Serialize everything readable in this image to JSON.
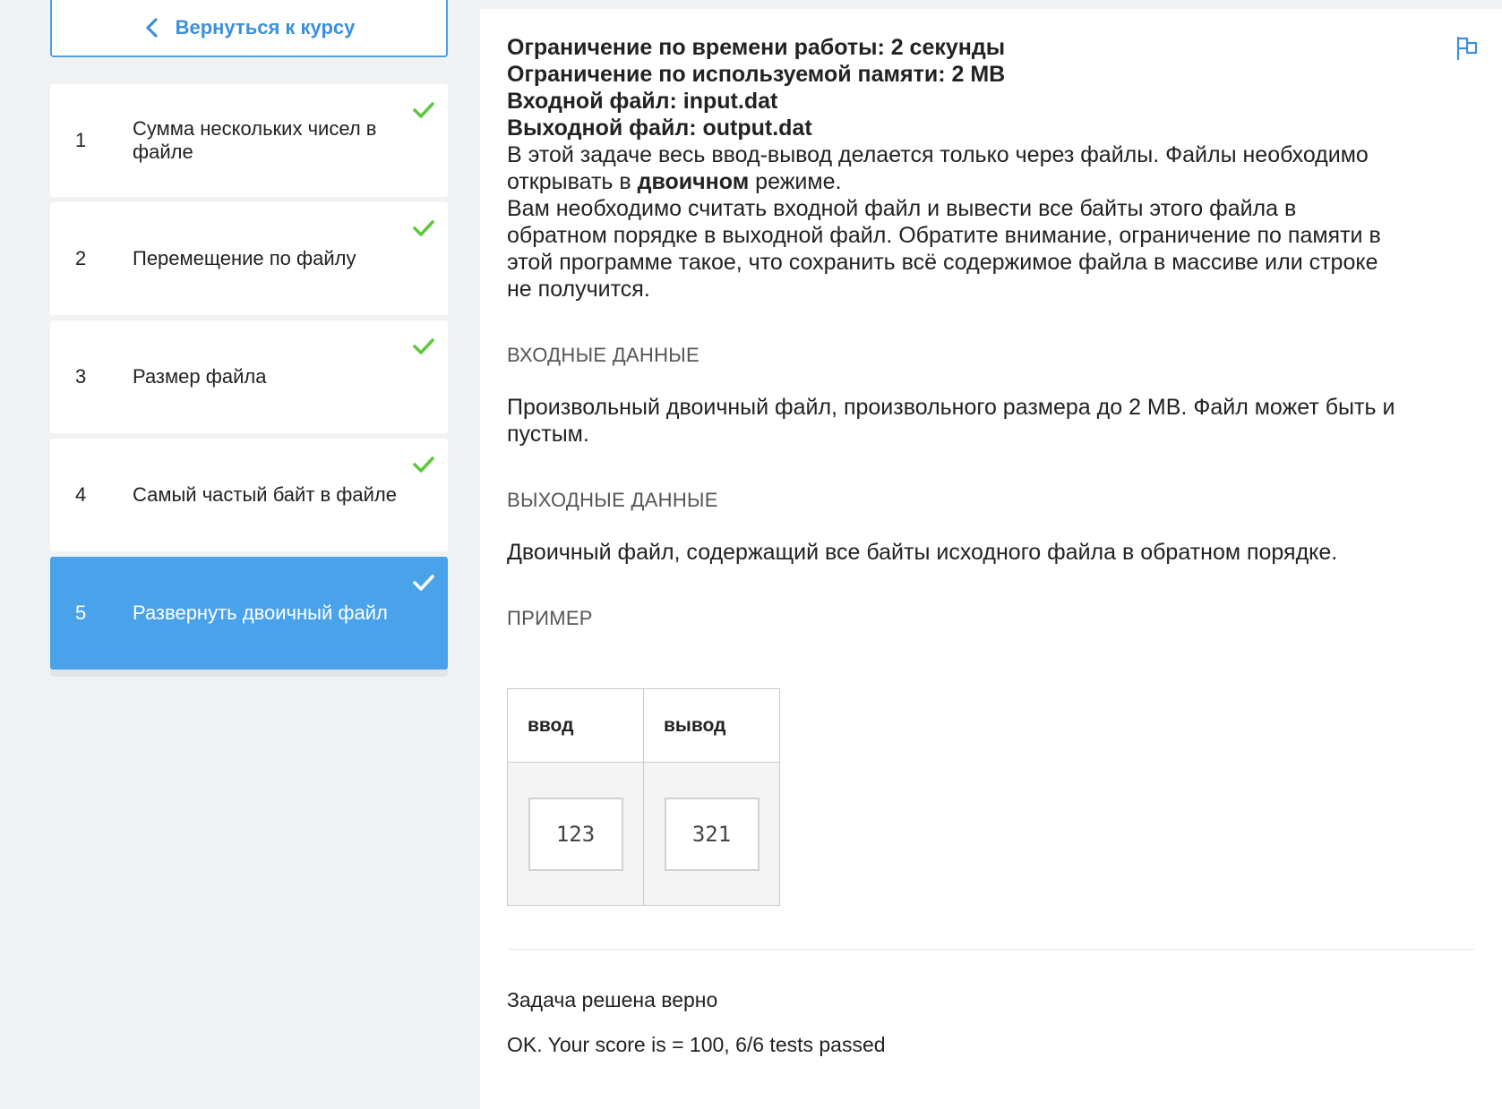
{
  "sidebar": {
    "back_label": "Вернуться к курсу",
    "lessons": [
      {
        "num": "1",
        "title": "Сумма нескольких чисел в файле",
        "done": true
      },
      {
        "num": "2",
        "title": "Перемещение по файлу",
        "done": true
      },
      {
        "num": "3",
        "title": "Размер файла",
        "done": true
      },
      {
        "num": "4",
        "title": "Самый частый байт в файле",
        "done": true
      },
      {
        "num": "5",
        "title": "Развернуть двоичный файл",
        "done": true,
        "active": true
      }
    ]
  },
  "problem": {
    "time_limit": "Ограничение по времени работы: 2 секунды",
    "memory_limit": "Ограничение по используемой памяти: 2 MB",
    "input_file": "Входной файл: input.dat",
    "output_file": "Выходной файл: output.dat",
    "statement_p1_before": "В этой задаче весь ввод-вывод делается только через файлы. Файлы необходимо открывать в ",
    "statement_p1_bold": "двоичном",
    "statement_p1_after": " режиме.",
    "statement_p2": "Вам необходимо считать входной файл и вывести все байты этого файла в обратном порядке в выходной файл. Обратите внимание, ограничение по памяти в этой программе такое, что сохранить всё содержимое файла в массиве или строке не получится.",
    "input_title": "ВХОДНЫЕ ДАННЫЕ",
    "input_desc": "Произвольный двоичный файл, произвольного размера до 2 MB. Файл может быть и пустым.",
    "output_title": "ВЫХОДНЫЕ ДАННЫЕ",
    "output_desc": "Двоичный файл, содержащий все байты исходного файла в обратном порядке.",
    "example_title": "ПРИМЕР",
    "example": {
      "col_input": "ввод",
      "col_output": "вывод",
      "input_value": "123",
      "output_value": "321"
    }
  },
  "result": {
    "status": "Задача решена верно",
    "score": "OK. Your score is = 100, 6/6 tests passed"
  },
  "colors": {
    "accent": "#4aa3ea",
    "check": "#5cc83a",
    "background": "#f1f2f4"
  },
  "icons": [
    "chevron-left-icon",
    "check-icon",
    "flag-icon"
  ]
}
